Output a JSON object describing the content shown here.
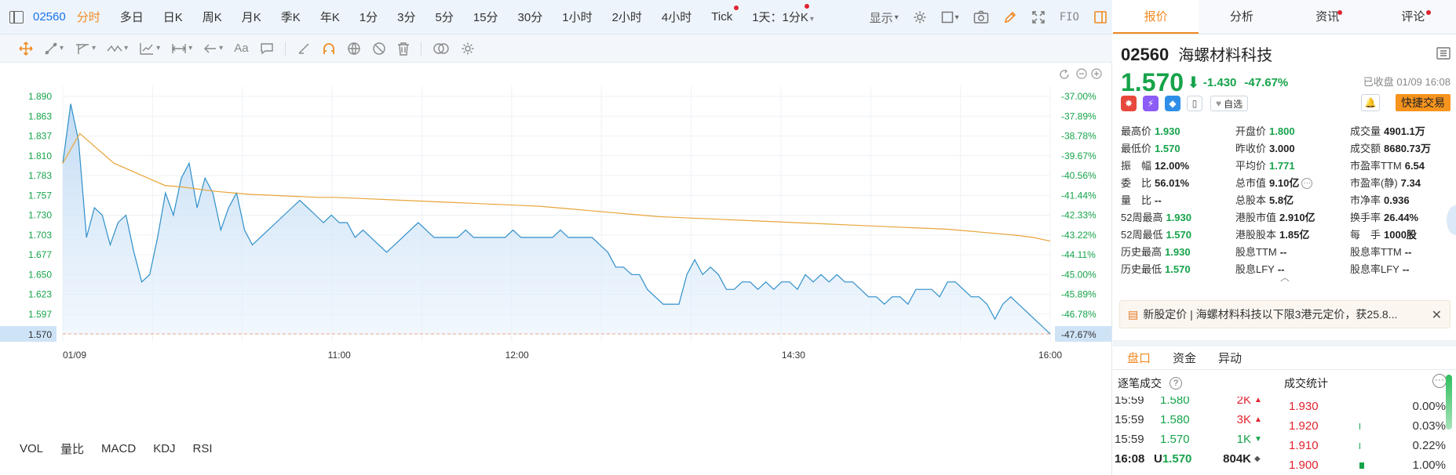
{
  "period_bar": {
    "code": "02560",
    "tabs": [
      "分时",
      "多日",
      "日K",
      "周K",
      "月K",
      "季K",
      "年K",
      "1分",
      "3分",
      "5分",
      "15分",
      "30分",
      "1小时",
      "2小时",
      "4小时",
      "Tick",
      "1天：1分K"
    ],
    "active_tab": "分时",
    "display_label": "显示",
    "fio_label": "FIO"
  },
  "indicators": [
    "VOL",
    "量比",
    "MACD",
    "KDJ",
    "RSI"
  ],
  "colors": {
    "accent": "#f08a24",
    "down": "#16a34a",
    "up": "#e0232e",
    "price_line": "#2f8fc9",
    "avg_line": "#e8a53a"
  },
  "chart_data": {
    "type": "line",
    "series": [
      {
        "values": [
          1.8,
          1.88,
          1.83,
          1.7,
          1.74,
          1.73,
          1.69,
          1.72,
          1.73,
          1.68,
          1.64,
          1.65,
          1.7,
          1.76,
          1.73,
          1.78,
          1.8,
          1.74,
          1.78,
          1.76,
          1.71,
          1.74,
          1.76,
          1.71,
          1.69,
          1.7,
          1.71,
          1.72,
          1.73,
          1.74,
          1.75,
          1.74,
          1.73,
          1.72,
          1.73,
          1.72,
          1.72,
          1.7,
          1.71,
          1.7,
          1.69,
          1.68,
          1.69,
          1.7,
          1.71,
          1.72,
          1.71,
          1.7,
          1.7,
          1.7,
          1.7,
          1.71,
          1.7,
          1.7,
          1.7,
          1.7,
          1.7,
          1.71,
          1.7,
          1.7,
          1.7,
          1.7,
          1.7,
          1.71,
          1.7,
          1.7,
          1.7,
          1.7,
          1.69,
          1.68,
          1.66,
          1.66,
          1.65,
          1.65,
          1.63,
          1.62,
          1.61,
          1.61,
          1.61,
          1.65,
          1.67,
          1.65,
          1.66,
          1.65,
          1.63,
          1.63,
          1.64,
          1.64,
          1.63,
          1.64,
          1.63,
          1.64,
          1.64,
          1.63,
          1.65,
          1.64,
          1.65,
          1.64,
          1.65,
          1.64,
          1.64,
          1.63,
          1.62,
          1.62,
          1.61,
          1.62,
          1.62,
          1.61,
          1.63,
          1.63,
          1.63,
          1.62,
          1.64,
          1.64,
          1.63,
          1.62,
          1.62,
          1.61,
          1.59,
          1.61,
          1.62,
          1.61,
          1.6,
          1.59,
          1.58,
          1.57
        ]
      },
      {
        "values": [
          1.8,
          1.84,
          1.82,
          1.8,
          1.79,
          1.78,
          1.77,
          1.768,
          1.765,
          1.762,
          1.76,
          1.758,
          1.757,
          1.756,
          1.755,
          1.754,
          1.754,
          1.753,
          1.752,
          1.751,
          1.75,
          1.749,
          1.748,
          1.747,
          1.746,
          1.745,
          1.744,
          1.743,
          1.742,
          1.74,
          1.738,
          1.736,
          1.734,
          1.732,
          1.73,
          1.728,
          1.727,
          1.726,
          1.725,
          1.724,
          1.723,
          1.722,
          1.721,
          1.72,
          1.719,
          1.718,
          1.717,
          1.716,
          1.715,
          1.714,
          1.713,
          1.712,
          1.711,
          1.709,
          1.707,
          1.705,
          1.703,
          1.7,
          1.695
        ]
      }
    ],
    "ylim": [
      1.57,
      1.89
    ],
    "y_ticks": [
      "1.890",
      "1.863",
      "1.837",
      "1.810",
      "1.783",
      "1.757",
      "1.730",
      "1.703",
      "1.677",
      "1.650",
      "1.623",
      "1.597",
      "1.570"
    ],
    "y_pct_ticks": [
      "-37.00%",
      "-37.89%",
      "-38.78%",
      "-39.67%",
      "-40.56%",
      "-41.44%",
      "-42.33%",
      "-43.22%",
      "-44.11%",
      "-45.00%",
      "-45.89%",
      "-46.78%",
      "-47.67%"
    ],
    "x_ticks": [
      "01/09",
      "11:00",
      "12:00",
      "14:30",
      "16:00"
    ],
    "x_tick_positions": [
      0.0,
      0.28,
      0.46,
      0.74,
      1.0
    ],
    "last_price_label": "1.570",
    "last_pct_label": "-47.67%",
    "grid": true
  },
  "panel": {
    "tabs": [
      {
        "label": "报价",
        "dot": false
      },
      {
        "label": "分析",
        "dot": false
      },
      {
        "label": "资讯",
        "dot": true
      },
      {
        "label": "评论",
        "dot": true
      }
    ],
    "code": "02560",
    "name": "海螺材料科技",
    "price": "1.570",
    "change": "-1.430",
    "change_pct": "-47.67%",
    "status": "已收盘 01/09 16:08",
    "watch_label": "自选",
    "quick_trade_label": "快捷交易",
    "quotes": [
      [
        [
          "最高价",
          "1.930",
          "up"
        ],
        [
          "开盘价",
          "1.800",
          "up"
        ],
        [
          "成交量",
          "4901.1万",
          ""
        ]
      ],
      [
        [
          "最低价",
          "1.570",
          "up"
        ],
        [
          "昨收价",
          "3.000",
          ""
        ],
        [
          "成交额",
          "8680.73万",
          ""
        ]
      ],
      [
        [
          "振　幅",
          "12.00%",
          ""
        ],
        [
          "平均价",
          "1.771",
          "up"
        ],
        [
          "市盈率TTM",
          "6.54",
          ""
        ]
      ],
      [
        [
          "委　比",
          "56.01%",
          ""
        ],
        [
          "总市值",
          "9.10亿",
          ""
        ],
        [
          "市盈率(静)",
          "7.34",
          ""
        ]
      ],
      [
        [
          "量　比",
          "--",
          ""
        ],
        [
          "总股本",
          "5.8亿",
          ""
        ],
        [
          "市净率",
          "0.936",
          ""
        ]
      ],
      [
        [
          "52周最高",
          "1.930",
          "up"
        ],
        [
          "港股市值",
          "2.910亿",
          ""
        ],
        [
          "换手率",
          "26.44%",
          ""
        ]
      ],
      [
        [
          "52周最低",
          "1.570",
          "up"
        ],
        [
          "港股股本",
          "1.85亿",
          ""
        ],
        [
          "每　手",
          "1000股",
          ""
        ]
      ],
      [
        [
          "历史最高",
          "1.930",
          "up"
        ],
        [
          "股息TTM",
          "--",
          ""
        ],
        [
          "股息率TTM",
          "--",
          ""
        ]
      ],
      [
        [
          "历史最低",
          "1.570",
          "up"
        ],
        [
          "股息LFY",
          "--",
          ""
        ],
        [
          "股息率LFY",
          "--",
          ""
        ]
      ]
    ],
    "news": "新股定价 | 海螺材料科技以下限3港元定价，获25.8...",
    "sub_tabs": [
      "盘口",
      "资金",
      "异动"
    ],
    "ticks_title": "逐笔成交",
    "ticks": [
      {
        "time": "15:59",
        "price": "1.580",
        "vol": "2K",
        "dir": "up"
      },
      {
        "time": "15:59",
        "price": "1.580",
        "vol": "3K",
        "dir": "up"
      },
      {
        "time": "15:59",
        "price": "1.570",
        "vol": "1K",
        "dir": "down"
      },
      {
        "time": "16:08",
        "flag": "U",
        "price": "1.570",
        "vol": "804K",
        "dir": "neutral"
      }
    ],
    "stats_title": "成交统计",
    "stats": [
      {
        "price": "1.930",
        "ratio": "0.00%",
        "share": 0.0
      },
      {
        "price": "1.920",
        "ratio": "0.03%",
        "share": 0.03
      },
      {
        "price": "1.910",
        "ratio": "0.22%",
        "share": 0.22
      },
      {
        "price": "1.900",
        "ratio": "1.00%",
        "share": 1.0
      }
    ]
  }
}
